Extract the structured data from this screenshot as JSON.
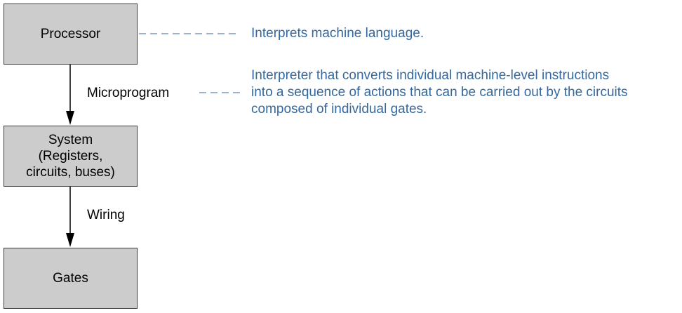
{
  "nodes": {
    "processor": {
      "label": "Processor"
    },
    "system": {
      "label": "System\n(Registers,\ncircuits, buses)"
    },
    "gates": {
      "label": "Gates"
    }
  },
  "edges": {
    "processor_to_system": {
      "label": "Microprogram"
    },
    "system_to_gates": {
      "label": "Wiring"
    }
  },
  "annotations": {
    "processor_note": "Interprets machine language.",
    "microprogram_note": "Interpreter that converts individual machine-level instructions\ninto a sequence of actions that can be carried out by the circuits\ncomposed of individual gates."
  },
  "colors": {
    "box_fill": "#cccccc",
    "box_border": "#3b3b3b",
    "annotation_text": "#34689e",
    "leader_line": "#34689e",
    "arrow": "#000000"
  }
}
